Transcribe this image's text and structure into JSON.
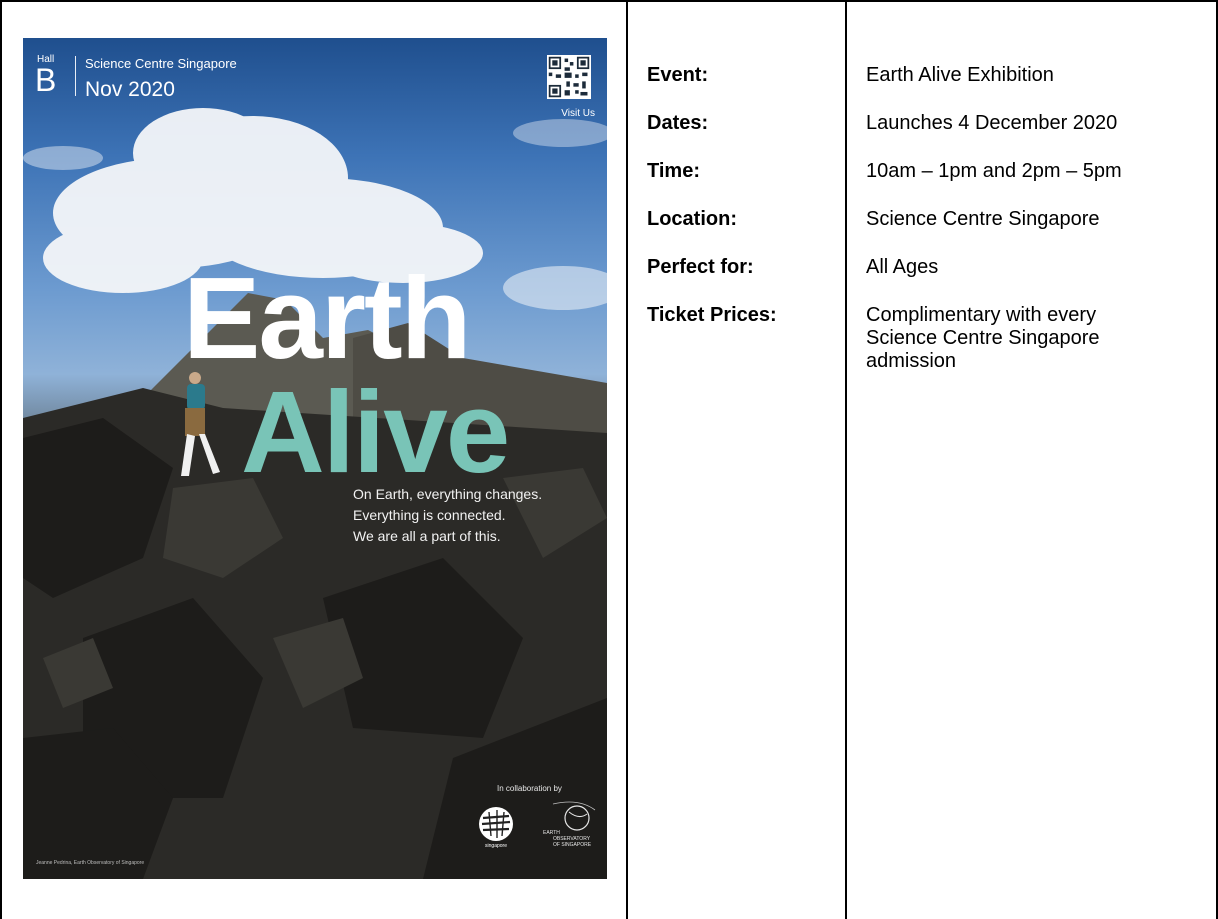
{
  "poster": {
    "hall_label": "Hall",
    "hall_letter": "B",
    "venue": "Science Centre Singapore",
    "month": "Nov 2020",
    "qr_caption": "Visit Us",
    "title_line1": "Earth",
    "title_line2": "Alive",
    "tagline": [
      "On Earth, everything changes.",
      "Everything is connected.",
      "We are all a part of this."
    ],
    "collab_label": "In collaboration by",
    "logo_science_centre": "SCIENCE CENTRE singapore",
    "logo_earth_observatory": "EARTH OBSERVATORY OF SINGAPORE",
    "photo_credit": "Jeanne Pedrina, Earth Observatory of Singapore",
    "accent_color": "#79c4b7"
  },
  "details": {
    "event_label": "Event:",
    "event_value": "Earth Alive Exhibition",
    "dates_label": "Dates:",
    "dates_value": "Launches 4 December 2020",
    "time_label": "Time:",
    "time_value": "10am – 1pm and 2pm – 5pm",
    "location_label": "Location:",
    "location_value": "Science Centre Singapore",
    "audience_label": "Perfect for:",
    "audience_value": "All Ages",
    "tickets_label": "Ticket Prices:",
    "tickets_value": "Complimentary with every Science Centre Singapore admission"
  }
}
